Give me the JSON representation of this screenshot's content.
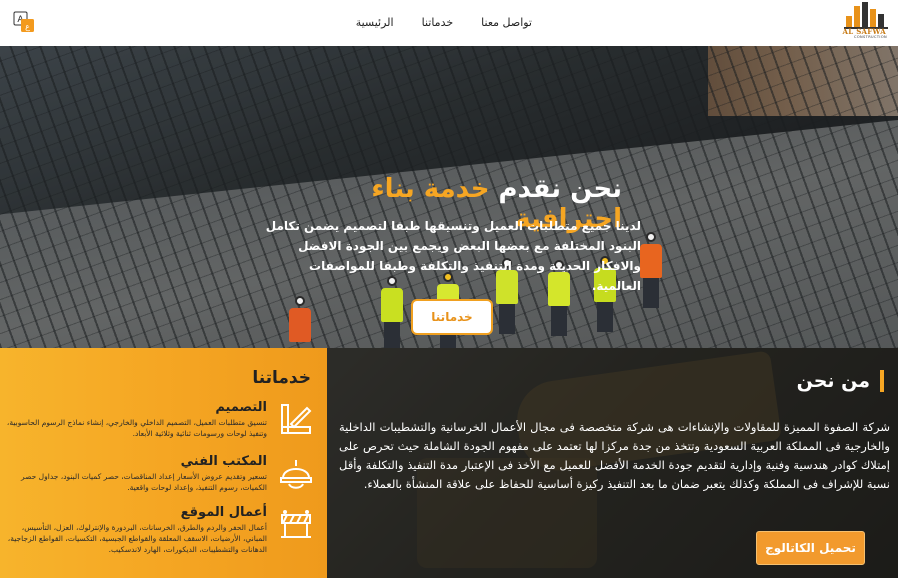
{
  "brand": {
    "name": "AL SAFWA",
    "tagline": "CONSTRUCTION",
    "accent": "#f6a623"
  },
  "nav": {
    "items": [
      "الرئيسية",
      "خدماتنا",
      "تواصل معنا"
    ]
  },
  "language": {
    "icon": "translate-icon"
  },
  "hero": {
    "title_main": "نحن نقدم",
    "title_accent": "خدمة بناء احترافية",
    "text": "لدينا جميع متطلبات العميل وتنسيقها طبقا لتصميم يضمن تكامل البنود المختلفة مع بعضها البعض ويجمع بين الجودة الافضل والافكار الحديثة ومدة التنفيذ والتكلفة وطبقا للمواصفات العالمية.",
    "button": "خدماتنا"
  },
  "services": {
    "title": "خدماتنا",
    "items": [
      {
        "icon": "design-tools-icon",
        "title": "التصميم",
        "description": "تنسيق متطلبات العميل، التصميم الداخلي والخارجي، إنشاء نماذج الرسوم الحاسوبية، وتنفيذ لوحات ورسومات ثنائية وثلاثية الأبعاد."
      },
      {
        "icon": "engineer-helmet-icon",
        "title": "المكتب الفني",
        "description": "تسعير وتقديم عروض الأسعار إعداد المناقصات، حصر كميات البنود، جداول حصر الكميات، رسوم التنفيذ، وإعداد لوحات واقعية."
      },
      {
        "icon": "barrier-icon",
        "title": "أعمال الموقع",
        "description": "أعمال الحفر والردم والطرق، الخرسانات، البردورة والإنترلوك، العزل، التأسيس، المباني، الأرضيات، الاسقف المعلقة والقواطع الجبسية، التكسيات، القواطع الزجاجية، الدهانات والتشطيبات، الديكورات، الهارد لاندسكيب."
      }
    ]
  },
  "about": {
    "title": "من نحن",
    "text": "شركة الصفوة المميزة للمقاولات والإنشاءات هى شركة متخصصة فى مجال الأعمال الخرسانية والتشطيبات الداخلية والخارجية فى المملكة العربية السعودية وتتخذ من جدة مركزا لها تعتمد على مفهوم الجودة الشاملة حيث تحرص على إمتلاك كوادر هندسية وفنية وإدارية لتقديم جودة الخدمة الأفضل للعميل مع الأخذ فى الإعتبار مدة التنفيذ والتكلفة وأقل نسبة للإشراف فى المملكة وكذلك يتعبر ضمان ما بعد التنفيذ ركيزة أساسية للحفاظ على علاقة المنشأة بالعملاء.",
    "button": "تحميل الكاتالوج"
  }
}
